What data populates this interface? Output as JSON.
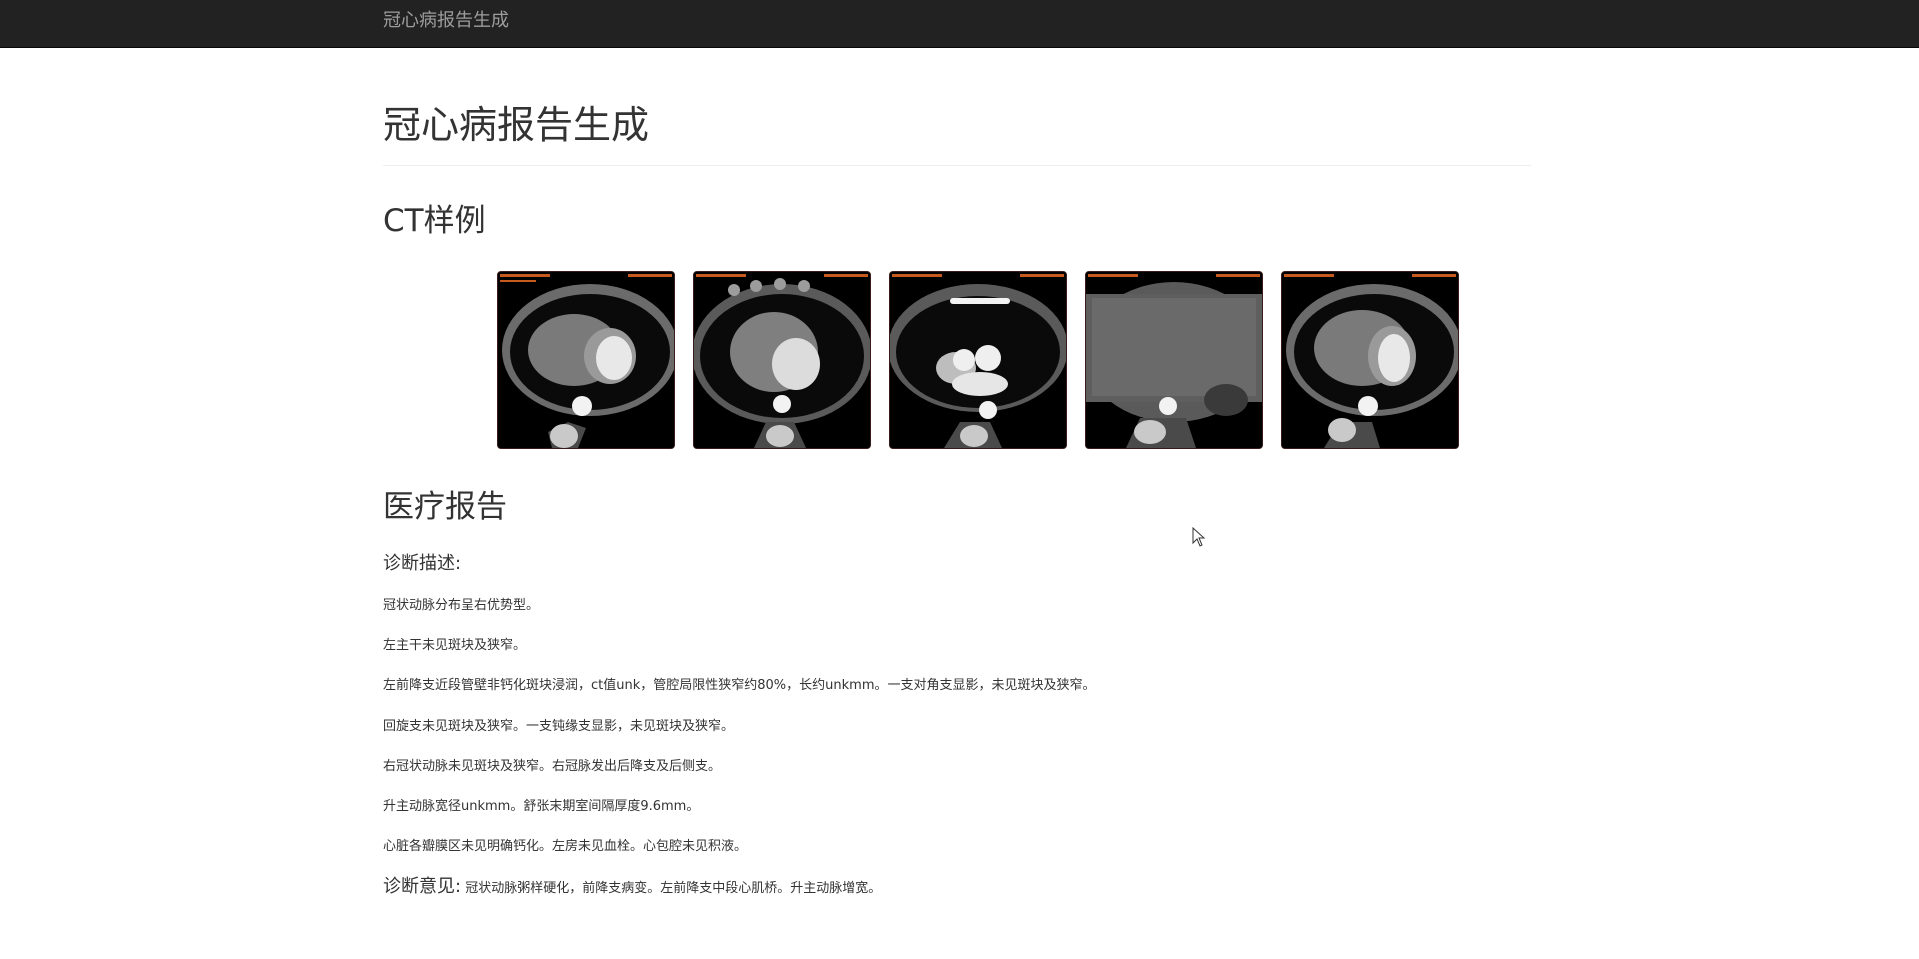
{
  "navbar": {
    "brand": "冠心病报告生成"
  },
  "page": {
    "title": "冠心病报告生成"
  },
  "ct_section": {
    "title": "CT样例",
    "images": [
      {
        "name": "ct-image-1"
      },
      {
        "name": "ct-image-2"
      },
      {
        "name": "ct-image-3"
      },
      {
        "name": "ct-image-4"
      },
      {
        "name": "ct-image-5"
      }
    ]
  },
  "report": {
    "title": "医疗报告",
    "description_label": "诊断描述:",
    "lines": [
      "冠状动脉分布呈右优势型。",
      "左主干未见斑块及狭窄。",
      "左前降支近段管壁非钙化斑块浸润，ct值unk，管腔局限性狭窄约80%，长约unkmm。一支对角支显影，未见斑块及狭窄。",
      "回旋支未见斑块及狭窄。一支钝缘支显影，未见斑块及狭窄。",
      "右冠状动脉未见斑块及狭窄。右冠脉发出后降支及后侧支。",
      "升主动脉宽径unkmm。舒张末期室间隔厚度9.6mm。",
      "心脏各瓣膜区未见明确钙化。左房未见血栓。心包腔未见积液。"
    ],
    "opinion_label": "诊断意见:",
    "opinion_text": " 冠状动脉粥样硬化，前降支病变。左前降支中段心肌桥。升主动脉增宽。"
  }
}
